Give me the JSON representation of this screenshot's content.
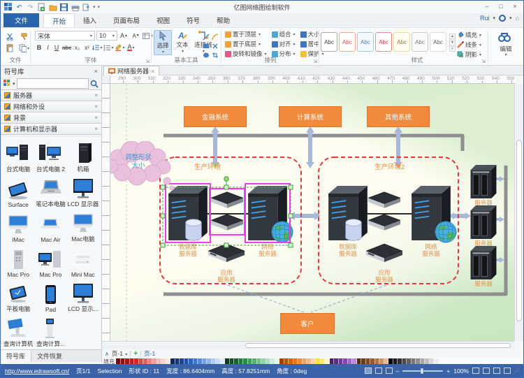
{
  "window": {
    "title": "亿图网络图绘制软件",
    "user_menu": "Rui",
    "minimize": "–",
    "maximize": "□",
    "close": "×"
  },
  "quick_access": {
    "icons": [
      "app-logo",
      "undo",
      "redo",
      "new",
      "open",
      "save",
      "print",
      "export"
    ]
  },
  "tabs": {
    "items": [
      {
        "label": "文件",
        "type": "file"
      },
      {
        "label": "开始",
        "type": "active"
      },
      {
        "label": "插入",
        "type": "normal"
      },
      {
        "label": "页面布局",
        "type": "normal"
      },
      {
        "label": "视图",
        "type": "normal"
      },
      {
        "label": "符号",
        "type": "normal"
      },
      {
        "label": "帮助",
        "type": "normal"
      }
    ]
  },
  "ribbon": {
    "file_group": {
      "label": "文件"
    },
    "font_group": {
      "label": "字体",
      "font_name": "宋体",
      "font_size": "10",
      "bold": "B",
      "italic": "I",
      "underline": "U",
      "strike": "abc",
      "sub": "x₂",
      "sup": "x²"
    },
    "basic_group": {
      "label": "基本工具",
      "select": "选择",
      "text": "文本",
      "connector": "连接线"
    },
    "arrange_group": {
      "label": "排列",
      "items": [
        {
          "label": "置于顶层",
          "color": "#f0a33c"
        },
        {
          "label": "组合",
          "color": "#4aa8d8"
        },
        {
          "label": "大小",
          "color": "#3f74c2"
        },
        {
          "label": "置于底层",
          "color": "#f0a33c"
        },
        {
          "label": "对齐",
          "color": "#3f74c2"
        },
        {
          "label": "居中",
          "color": "#3f74c2"
        },
        {
          "label": "旋转和镜像",
          "color": "#e05a8c"
        },
        {
          "label": "分布",
          "color": "#4aa8d8"
        },
        {
          "label": "保护",
          "color": "#f0c23c"
        }
      ]
    },
    "style_group": {
      "label": "样式",
      "swatches": [
        {
          "label": "Abc",
          "border": "#a9a9a9",
          "color": "#3c3c3c",
          "bg": "#ffffff"
        },
        {
          "label": "Abc",
          "border": "#f2b48c",
          "color": "#d9534f",
          "bg": "#ffffff"
        },
        {
          "label": "Abc",
          "border": "#a8c8e8",
          "color": "#4a7fc1",
          "bg": "#f5faff"
        },
        {
          "label": "Abc",
          "border": "#e88a8a",
          "color": "#d43c3c",
          "bg": "#ffffff"
        },
        {
          "label": "Abc",
          "border": "#f2d996",
          "color": "#9a7d3a",
          "bg": "#fffdf2"
        },
        {
          "label": "Abc",
          "border": "#c9c9c9",
          "color": "#7a7a7a",
          "bg": "#fafafa"
        },
        {
          "label": "Abc",
          "border": "#d9d9d9",
          "color": "#5a5a5a",
          "bg": "#ffffff"
        }
      ],
      "fill": "填充",
      "line": "线条",
      "shadow": "阴影"
    },
    "edit_group": {
      "label": "编辑"
    }
  },
  "sidebar": {
    "title": "符号库",
    "categories": [
      {
        "label": "服务器"
      },
      {
        "label": "网络和外设"
      },
      {
        "label": "背景"
      },
      {
        "label": "计算机和显示器"
      }
    ],
    "items": [
      {
        "label": "台式电脑",
        "icon": "desktop"
      },
      {
        "label": "台式电脑 2",
        "icon": "desktop2"
      },
      {
        "label": "机箱",
        "icon": "tower"
      },
      {
        "label": "Surface",
        "icon": "surface"
      },
      {
        "label": "笔记本电脑",
        "icon": "laptop"
      },
      {
        "label": "LCD 显示器",
        "icon": "monitor"
      },
      {
        "label": "iMac",
        "icon": "imac"
      },
      {
        "label": "Mac Air",
        "icon": "macair"
      },
      {
        "label": "Mac电脑",
        "icon": "imac"
      },
      {
        "label": "Mac Pro",
        "icon": "macpro"
      },
      {
        "label": "Mac Pro",
        "icon": "macpc"
      },
      {
        "label": "Mini Mac",
        "icon": "minimac"
      },
      {
        "label": "平板电脑",
        "icon": "tablet"
      },
      {
        "label": "Pad",
        "icon": "pad"
      },
      {
        "label": "LCD 显示...",
        "icon": "monitor"
      },
      {
        "label": "查询计算机",
        "icon": "kiosk"
      },
      {
        "label": "查询计算...",
        "icon": "kiosk2"
      }
    ],
    "bottom_tabs": [
      {
        "label": "符号库",
        "active": true
      },
      {
        "label": "文件恢复",
        "active": false
      }
    ]
  },
  "canvas": {
    "doc_tab": "网络服务器",
    "ruler": {
      "start": 290,
      "step": 10,
      "count": 28
    },
    "systems": [
      "金融系统",
      "计算系统",
      "其他系统"
    ],
    "env1": "生产环境",
    "env2": "生产环境2",
    "cloud_l1": "调整形状",
    "cloud_l2": "大小",
    "db_l1": "数据库",
    "db_l2": "服务器",
    "net_l1": "网络",
    "net_l2": "服务器",
    "app_l1": "应用",
    "app_l2": "服务器",
    "server": "服务器",
    "customer": "客户"
  },
  "pagebar": {
    "page_dropdown": "页-1",
    "add": "+",
    "tab": "页-1"
  },
  "palette": {
    "label": "填充",
    "colors": [
      "#6e0b0b",
      "#8c1010",
      "#a81515",
      "#c01a1a",
      "#d42626",
      "#de4545",
      "#e66363",
      "#ec8181",
      "#f19f9f",
      "#f5baba",
      "#f9d2d2",
      "#fce4e4",
      "#0d2857",
      "#123572",
      "#17438e",
      "#1d52aa",
      "#2562c6",
      "#3b76d2",
      "#578bdb",
      "#73a0e3",
      "#8fb5eb",
      "#abc9f1",
      "#c7ddf7",
      "#ddebfa",
      "#0c3a1c",
      "#114f26",
      "#166530",
      "#1c7b3a",
      "#239145",
      "#38a257",
      "#55b271",
      "#72c28b",
      "#8fd2a5",
      "#ace1bf",
      "#c9f0d9",
      "#ddf6e8",
      "#a33d00",
      "#bf4d00",
      "#d85e04",
      "#ea7317",
      "#f18a3a",
      "#f5a260",
      "#f8ba86",
      "#fbd2ac",
      "#ffdf3d",
      "#ffe97a",
      "#fff4c0",
      "#47215f",
      "#5d2c7c",
      "#733799",
      "#8943b5",
      "#a465c8",
      "#bf88da",
      "#502c12",
      "#693a18",
      "#82481e",
      "#9b5624",
      "#b3723f",
      "#cc9566",
      "#e4b88d",
      "#000000",
      "#181818",
      "#303030",
      "#484848",
      "#606060",
      "#787878",
      "#909090",
      "#a8a8a8",
      "#c0c0c0",
      "#d8d8d8",
      "#f0f0f0"
    ]
  },
  "statusbar": {
    "link": "http://www.edrawsoft.cn/",
    "page": "页1/1",
    "mode": "Selection",
    "shape_id": "形状 ID : 11",
    "width": "宽度 : 86.6404mm",
    "height": "高度 : 57.8251mm",
    "angle": "角度 : 0deg",
    "zoom": "100%",
    "zoom_minus": "–",
    "zoom_plus": "+"
  }
}
